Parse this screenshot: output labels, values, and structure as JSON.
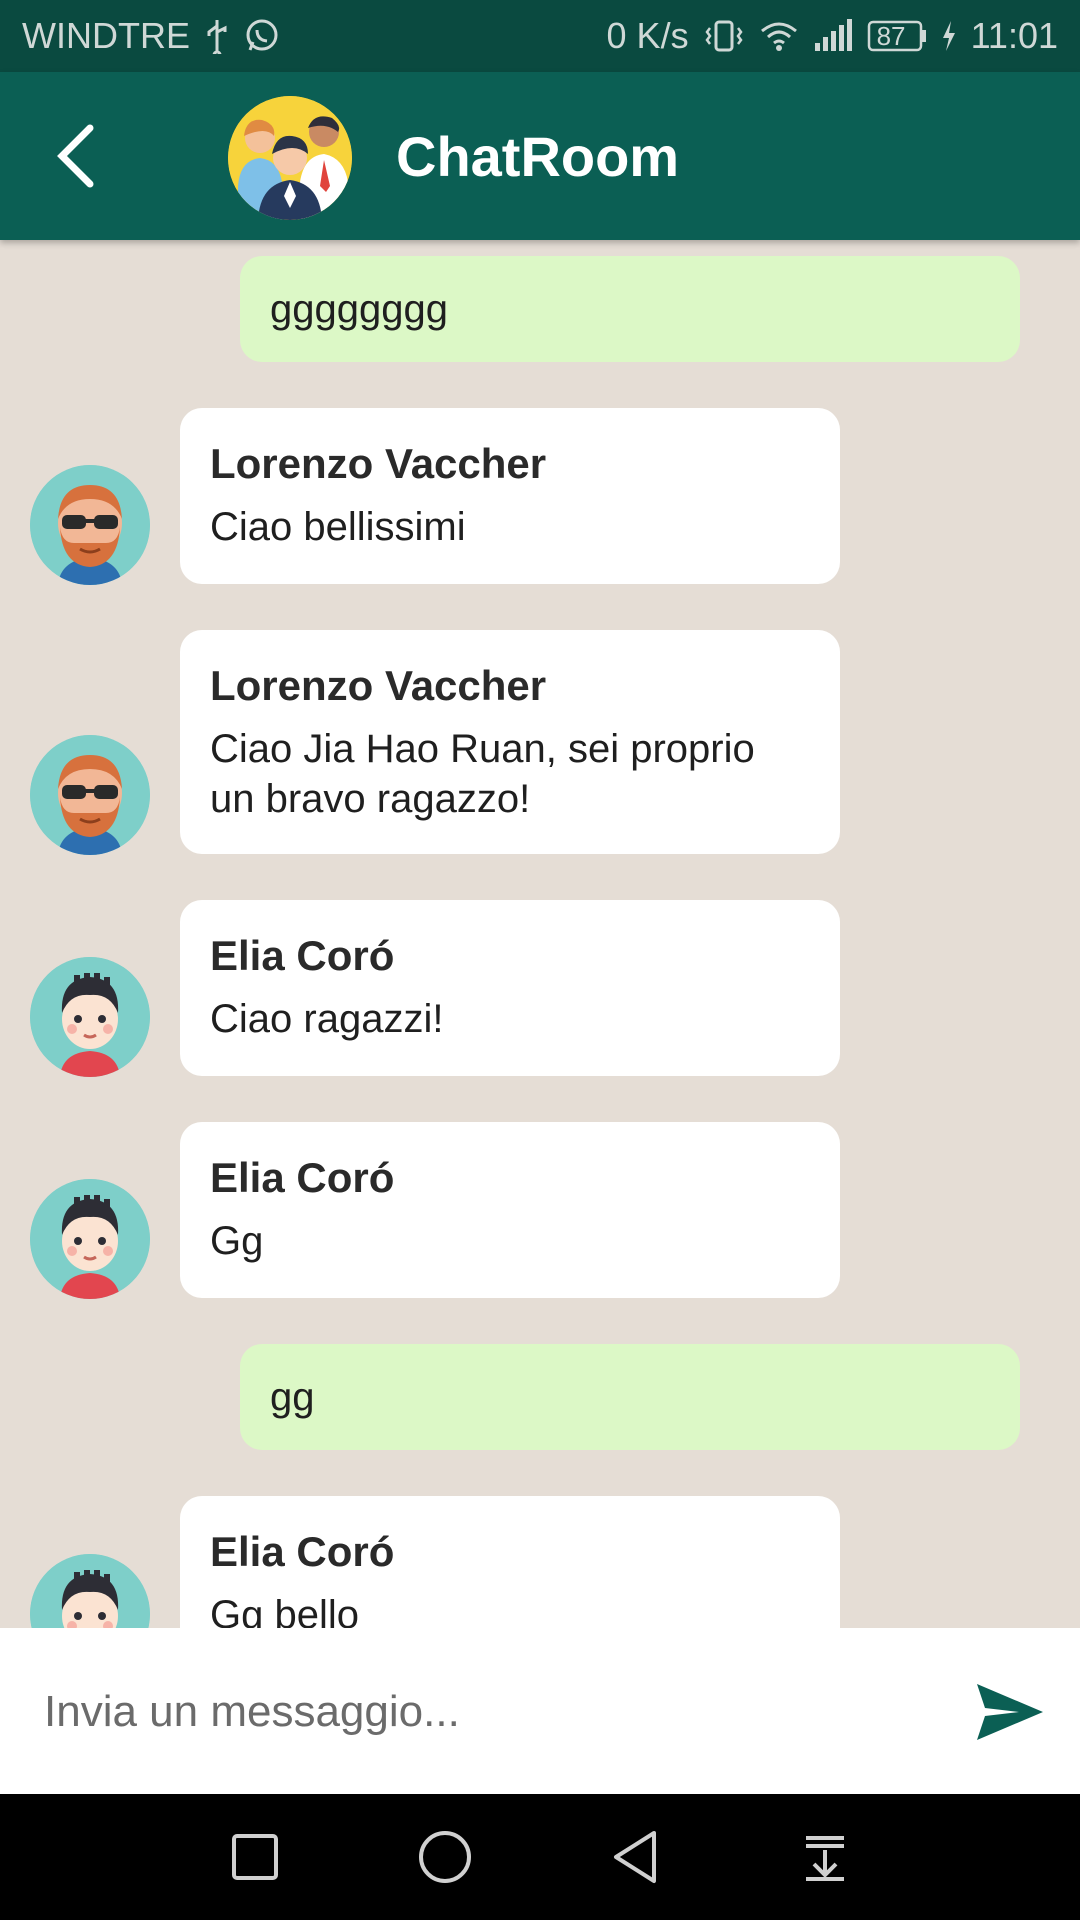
{
  "status_bar": {
    "carrier": "WINDTRE",
    "speed": "0 K/s",
    "battery": "87",
    "time": "11:01"
  },
  "header": {
    "title": "ChatRoom",
    "back_icon": "chevron-left-icon",
    "avatar": "group-avatar"
  },
  "messages": [
    {
      "type": "sent",
      "text": "gggggggg"
    },
    {
      "type": "received",
      "sender": "Lorenzo Vaccher",
      "text": "Ciao bellissimi"
    },
    {
      "type": "received",
      "sender": "Lorenzo Vaccher",
      "text": "Ciao Jia Hao Ruan, sei proprio un bravo ragazzo!"
    },
    {
      "type": "received",
      "sender": "Elia Coró",
      "text": "Ciao ragazzi!"
    },
    {
      "type": "received",
      "sender": "Elia Coró",
      "text": "Gg"
    },
    {
      "type": "sent",
      "text": "gg"
    },
    {
      "type": "received",
      "sender": "Elia Coró",
      "text": "Gg bello"
    }
  ],
  "composer": {
    "placeholder": "Invia un messaggio...",
    "send_icon": "send-icon"
  },
  "colors": {
    "status_bar": "#0a4a40",
    "app_bar": "#0b5f54",
    "chat_background": "#e5ddd5",
    "sent_bubble": "#dcf8c6",
    "received_bubble": "#ffffff",
    "send_icon": "#0b5f54"
  }
}
